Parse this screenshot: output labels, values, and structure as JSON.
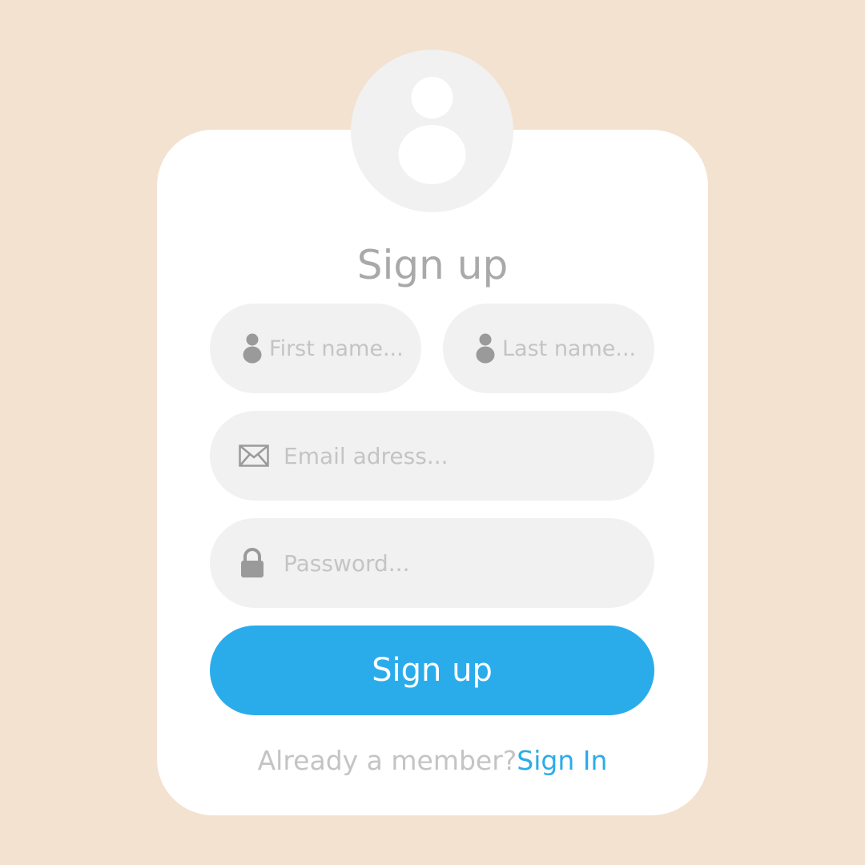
{
  "form": {
    "title": "Sign up",
    "avatar_icon": "user-avatar-icon",
    "fields": {
      "first_name": {
        "placeholder": "First name...",
        "icon": "user-icon"
      },
      "last_name": {
        "placeholder": "Last name...",
        "icon": "user-icon"
      },
      "email": {
        "placeholder": "Email adress...",
        "icon": "envelope-icon"
      },
      "password": {
        "placeholder": "Password...",
        "icon": "lock-icon"
      }
    },
    "submit_label": "Sign up",
    "footer": {
      "prompt": "Already a member?",
      "link_label": "Sign In"
    }
  },
  "colors": {
    "background": "#f3e2d0",
    "card": "#ffffff",
    "field": "#f1f1f1",
    "accent": "#2aaceb",
    "title_text": "#a9a9a9",
    "placeholder_text": "#c4c4c4",
    "icon": "#9a9a9a"
  }
}
